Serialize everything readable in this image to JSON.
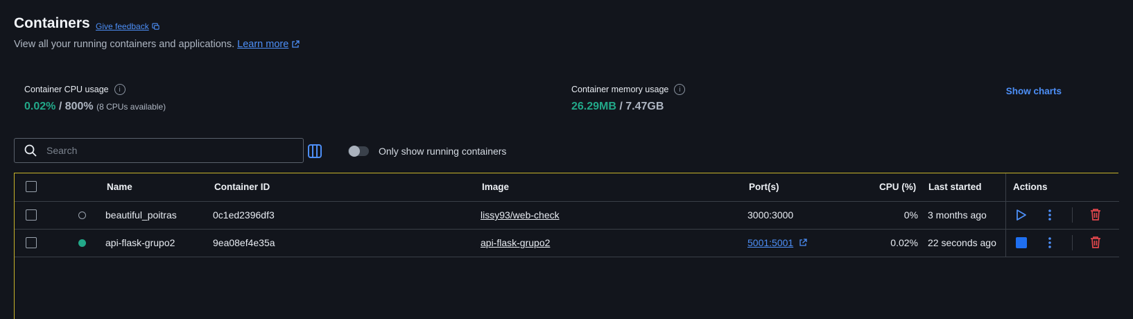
{
  "page": {
    "title": "Containers",
    "feedback_label": "Give feedback",
    "subtitle": "View all your running containers and applications.",
    "learn_more_label": "Learn more"
  },
  "stats": {
    "cpu": {
      "label": "Container CPU usage",
      "used": "0.02%",
      "total": "/ 800%",
      "note": "(8 CPUs available)"
    },
    "memory": {
      "label": "Container memory usage",
      "used": "26.29MB",
      "total": "/ 7.47GB"
    },
    "show_charts_label": "Show charts"
  },
  "toolbar": {
    "search_placeholder": "Search",
    "toggle_label": "Only show running containers"
  },
  "table": {
    "columns": [
      "Name",
      "Container ID",
      "Image",
      "Port(s)",
      "CPU (%)",
      "Last started",
      "Actions"
    ],
    "rows": [
      {
        "name": "beautiful_poitras",
        "id": "0c1ed2396df3",
        "image": "lissy93/web-check",
        "ports": "3000:3000",
        "cpu": "0%",
        "last_started": "3 months ago",
        "status": "stopped"
      },
      {
        "name": "api-flask-grupo2",
        "id": "9ea08ef4e35a",
        "image": "api-flask-grupo2",
        "ports": "5001:5001",
        "cpu": "0.02%",
        "last_started": "22 seconds ago",
        "status": "running"
      }
    ]
  },
  "colors": {
    "accent": "#4d8ff7",
    "running": "#22a889",
    "delete": "#e0474c",
    "background": "#12151c"
  },
  "icons": [
    "feedback-icon",
    "external-link-icon",
    "info-icon",
    "search-icon",
    "columns-icon",
    "play-icon",
    "stop-icon",
    "more-vertical-icon",
    "trash-icon"
  ]
}
